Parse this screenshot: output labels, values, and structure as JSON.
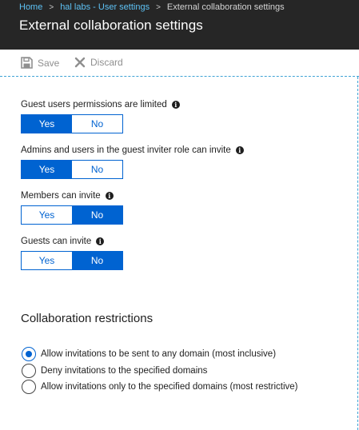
{
  "breadcrumb": {
    "items": [
      "Home",
      "hal labs - User settings"
    ],
    "current": "External collaboration settings",
    "separator": ">"
  },
  "blade": {
    "title": "External collaboration settings"
  },
  "toolbar": {
    "save_label": "Save",
    "discard_label": "Discard",
    "save_icon": "save-icon",
    "discard_icon": "close-icon"
  },
  "settings": [
    {
      "label": "Guest users permissions are limited",
      "yes": "Yes",
      "no": "No",
      "selected": "Yes"
    },
    {
      "label": "Admins and users in the guest inviter role can invite",
      "yes": "Yes",
      "no": "No",
      "selected": "Yes"
    },
    {
      "label": "Members can invite",
      "yes": "Yes",
      "no": "No",
      "selected": "No"
    },
    {
      "label": "Guests can invite",
      "yes": "Yes",
      "no": "No",
      "selected": "No"
    }
  ],
  "restrictions": {
    "heading": "Collaboration restrictions",
    "options": [
      {
        "label": "Allow invitations to be sent to any domain (most inclusive)",
        "checked": true
      },
      {
        "label": "Deny invitations to the specified domains",
        "checked": false
      },
      {
        "label": "Allow invitations only to the specified domains (most restrictive)",
        "checked": false
      }
    ]
  },
  "colors": {
    "header_bg": "#262626",
    "accent": "#0063d1",
    "link": "#5ec2f5"
  }
}
